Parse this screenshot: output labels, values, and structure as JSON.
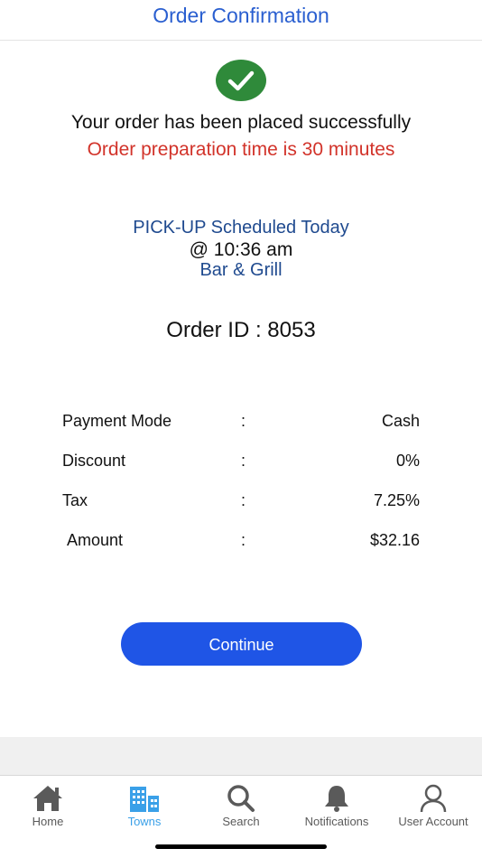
{
  "header": {
    "title": "Order Confirmation"
  },
  "confirmation": {
    "success_message": "Your order has been placed successfully",
    "prep_message": "Order preparation time is 30 minutes",
    "status_icon": "check-circle-icon",
    "accent_success": "#2f8a3a",
    "accent_warning": "#d2332a"
  },
  "pickup": {
    "schedule": "PICK-UP Scheduled Today",
    "time": "@ 10:36 am",
    "venue": "Bar & Grill"
  },
  "order": {
    "id_text": "Order ID : 8053"
  },
  "details": [
    {
      "label": "Payment Mode",
      "separator": ":",
      "value": "Cash"
    },
    {
      "label": "Discount",
      "separator": ":",
      "value": "0%"
    },
    {
      "label": "Tax",
      "separator": ":",
      "value": "7.25%"
    },
    {
      "label": "Amount",
      "separator": ":",
      "value": "$32.16"
    }
  ],
  "actions": {
    "continue_label": "Continue",
    "button_color": "#1f55e6"
  },
  "tabbar": {
    "items": [
      {
        "label": "Home",
        "icon": "home-icon",
        "active": false
      },
      {
        "label": "Towns",
        "icon": "city-buildings-icon",
        "active": true
      },
      {
        "label": "Search",
        "icon": "search-icon",
        "active": false
      },
      {
        "label": "Notifications",
        "icon": "bell-icon",
        "active": false
      },
      {
        "label": "User Account",
        "icon": "user-icon",
        "active": false
      }
    ],
    "active_color": "#3aa0e8"
  }
}
